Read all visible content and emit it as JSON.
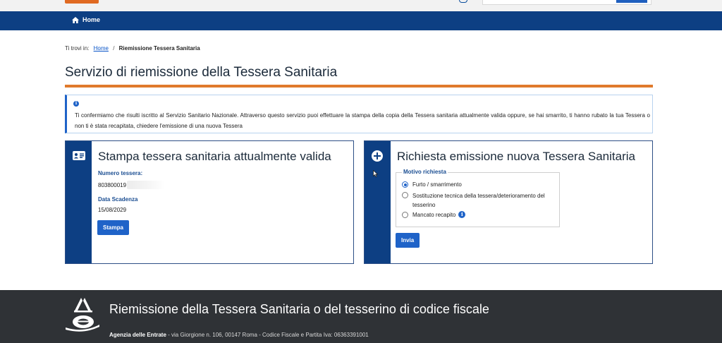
{
  "nav": {
    "home_label": "Home"
  },
  "breadcrumb": {
    "prefix": "Ti trovi in:",
    "home": "Home",
    "separator": "/",
    "current": "Riemissione Tessera Sanitaria"
  },
  "page": {
    "title": "Servizio di riemissione della Tessera Sanitaria"
  },
  "info": {
    "icon": "i",
    "text": "Ti confermiamo che risulti iscritto al Servizio Sanitario Nazionale. Attraverso questo servizio puoi effettuare la stampa della copia della Tessera sanitaria attualmente valida oppure, se hai smarrito, ti hanno rubato la tua Tessera o non ti è stata recapitata, chiedere l'emissione di una nuova Tessera"
  },
  "print_card": {
    "title": "Stampa tessera sanitaria attualmente valida",
    "number_label": "Numero tessera:",
    "number_value": "803800019",
    "expiry_label": "Data Scadenza",
    "expiry_value": "15/08/2029",
    "button": "Stampa"
  },
  "new_card": {
    "title": "Richiesta emissione nuova Tessera Sanitaria",
    "legend": "Motivo richiesta",
    "options": [
      {
        "label": "Furto / smarrimento",
        "checked": true
      },
      {
        "label": "Sostituzione tecnica della tessera/deterioramento del tesserino",
        "checked": false
      },
      {
        "label": "Mancato recapito",
        "checked": false
      }
    ],
    "tip_icon": "i",
    "button": "Invia"
  },
  "footer": {
    "title": "Riemissione della Tessera Sanitaria o del tesserino di codice fiscale",
    "org": "Agenzia delle Entrate",
    "address": " - via Giorgione n. 106, 00147 Roma - Codice Fiscale e Partita Iva: 06363391001"
  },
  "colors": {
    "nav": "#0d3f83",
    "accent": "#e07a2c",
    "button": "#1f63c8",
    "footer": "#2f3236"
  },
  "icons": {
    "home": "home-icon",
    "id_card": "id-card-icon",
    "plus": "plus-circle-icon",
    "info": "info-icon",
    "logo": "agenzia-entrate-logo"
  }
}
